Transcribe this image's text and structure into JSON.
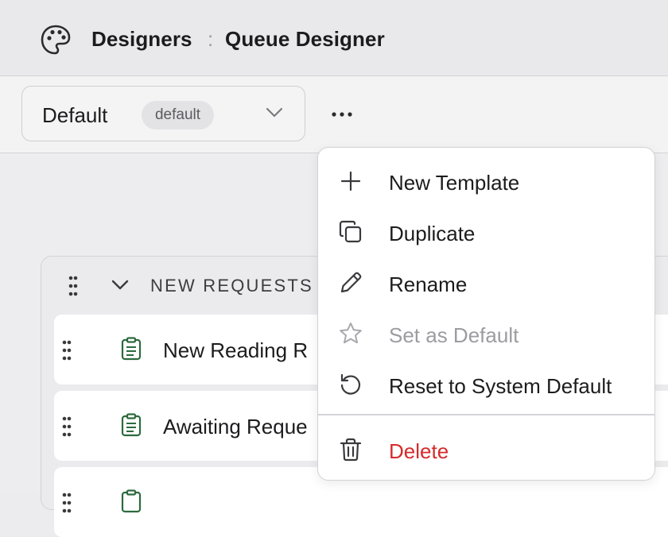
{
  "header": {
    "section": "Designers",
    "separator": ":",
    "page": "Queue Designer",
    "icon": "palette-icon"
  },
  "toolbar": {
    "template_select": {
      "value": "Default",
      "badge": "default"
    },
    "more_icon": "more-horizontal-icon"
  },
  "queue": {
    "group_label": "NEW REQUESTS",
    "rows": [
      {
        "label": "New Reading R"
      },
      {
        "label": "Awaiting Reque"
      },
      {
        "label": ""
      }
    ]
  },
  "menu": {
    "items": [
      {
        "label": "New Template",
        "icon": "plus-icon"
      },
      {
        "label": "Duplicate",
        "icon": "copy-icon"
      },
      {
        "label": "Rename",
        "icon": "pencil-icon"
      },
      {
        "label": "Set as Default",
        "icon": "star-icon",
        "disabled": true
      },
      {
        "label": "Reset to System Default",
        "icon": "reset-icon"
      },
      {
        "label": "Delete",
        "icon": "trash-icon",
        "danger": true
      }
    ]
  },
  "colors": {
    "accent_green": "#2d6a3e",
    "danger": "#d62b2b",
    "disabled": "#9c9ca1"
  }
}
